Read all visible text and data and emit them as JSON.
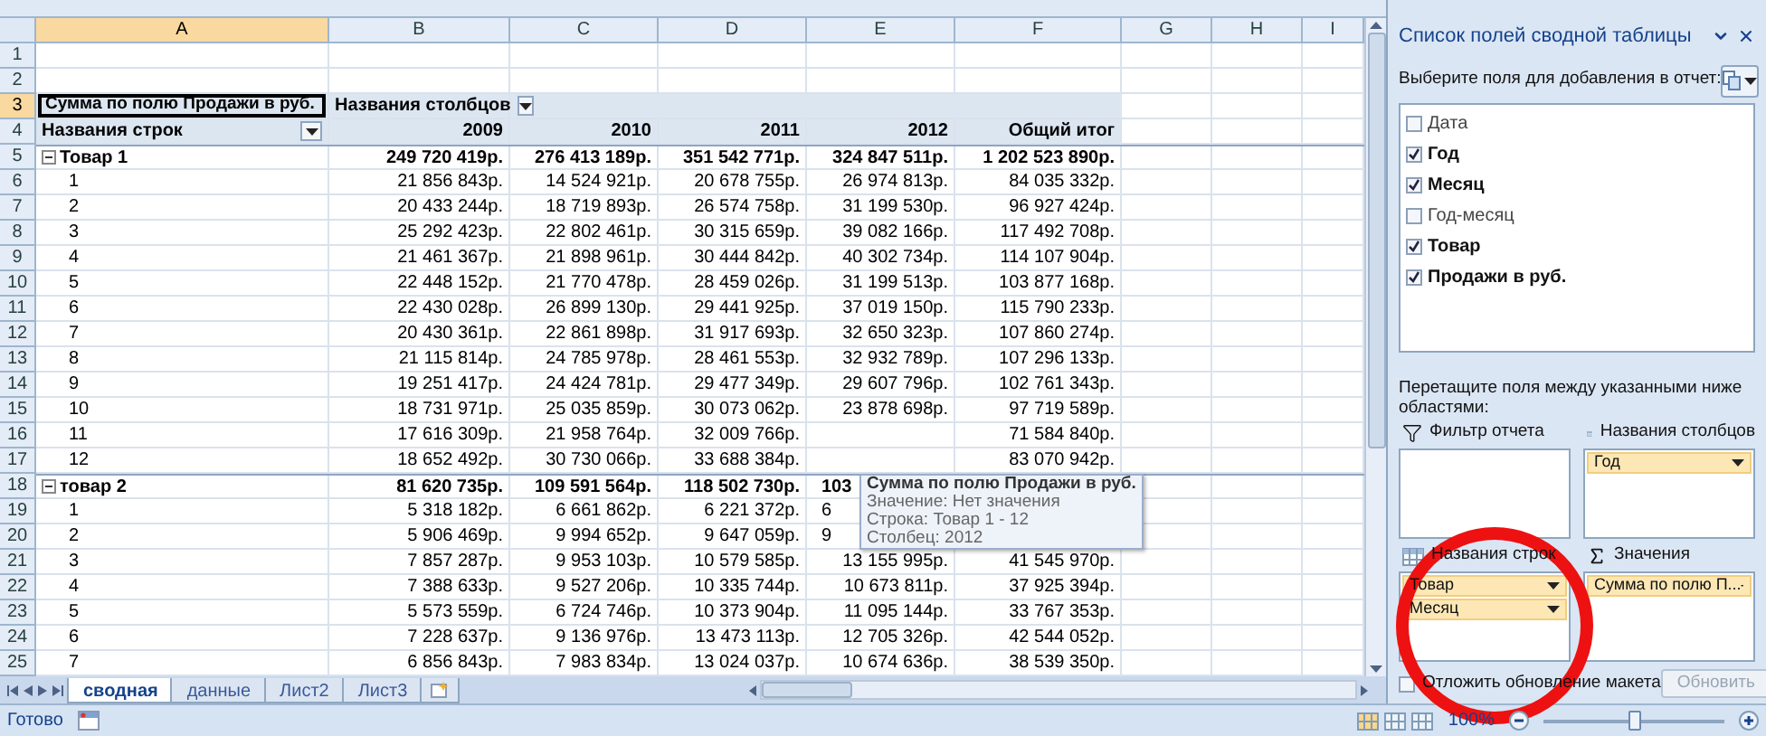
{
  "columns": [
    {
      "label": "A",
      "selected": true
    },
    {
      "label": "B",
      "selected": false
    },
    {
      "label": "C",
      "selected": false
    },
    {
      "label": "D",
      "selected": false
    },
    {
      "label": "E",
      "selected": false
    },
    {
      "label": "F",
      "selected": false
    },
    {
      "label": "G",
      "selected": false
    },
    {
      "label": "H",
      "selected": false
    },
    {
      "label": "I",
      "selected": false
    }
  ],
  "rows": [
    {
      "num": "1",
      "kind": "blank",
      "selected": false
    },
    {
      "num": "2",
      "kind": "blank",
      "selected": false
    },
    {
      "num": "3",
      "kind": "pivot_title",
      "selected": true,
      "label": "Сумма по полю Продажи в руб.",
      "column_label": "Названия столбцов"
    },
    {
      "num": "4",
      "kind": "pivot_header",
      "selected": false,
      "label": "Названия строк",
      "values": [
        "2009",
        "2010",
        "2011",
        "2012",
        "Общий итог"
      ]
    },
    {
      "num": "5",
      "kind": "group",
      "selected": false,
      "expanded": true,
      "label": "Товар 1",
      "cells": {
        "b": "249 720 419р.",
        "c": "276 413 189р.",
        "d": "351 542 771р.",
        "e": "324 847 511р.",
        "f": "1 202 523 890р."
      }
    },
    {
      "num": "6",
      "kind": "item",
      "selected": false,
      "label": "1",
      "cells": {
        "b": "21 856 843р.",
        "c": "14 524 921р.",
        "d": "20 678 755р.",
        "e": "26 974 813р.",
        "f": "84 035 332р."
      }
    },
    {
      "num": "7",
      "kind": "item",
      "selected": false,
      "label": "2",
      "cells": {
        "b": "20 433 244р.",
        "c": "18 719 893р.",
        "d": "26 574 758р.",
        "e": "31 199 530р.",
        "f": "96 927 424р."
      }
    },
    {
      "num": "8",
      "kind": "item",
      "selected": false,
      "label": "3",
      "cells": {
        "b": "25 292 423р.",
        "c": "22 802 461р.",
        "d": "30 315 659р.",
        "e": "39 082 166р.",
        "f": "117 492 708р."
      }
    },
    {
      "num": "9",
      "kind": "item",
      "selected": false,
      "label": "4",
      "cells": {
        "b": "21 461 367р.",
        "c": "21 898 961р.",
        "d": "30 444 842р.",
        "e": "40 302 734р.",
        "f": "114 107 904р."
      }
    },
    {
      "num": "10",
      "kind": "item",
      "selected": false,
      "label": "5",
      "cells": {
        "b": "22 448 152р.",
        "c": "21 770 478р.",
        "d": "28 459 026р.",
        "e": "31 199 513р.",
        "f": "103 877 168р."
      }
    },
    {
      "num": "11",
      "kind": "item",
      "selected": false,
      "label": "6",
      "cells": {
        "b": "22 430 028р.",
        "c": "26 899 130р.",
        "d": "29 441 925р.",
        "e": "37 019 150р.",
        "f": "115 790 233р."
      }
    },
    {
      "num": "12",
      "kind": "item",
      "selected": false,
      "label": "7",
      "cells": {
        "b": "20 430 361р.",
        "c": "22 861 898р.",
        "d": "31 917 693р.",
        "e": "32 650 323р.",
        "f": "107 860 274р."
      }
    },
    {
      "num": "13",
      "kind": "item",
      "selected": false,
      "label": "8",
      "cells": {
        "b": "21 115 814р.",
        "c": "24 785 978р.",
        "d": "28 461 553р.",
        "e": "32 932 789р.",
        "f": "107 296 133р."
      }
    },
    {
      "num": "14",
      "kind": "item",
      "selected": false,
      "label": "9",
      "cells": {
        "b": "19 251 417р.",
        "c": "24 424 781р.",
        "d": "29 477 349р.",
        "e": "29 607 796р.",
        "f": "102 761 343р."
      }
    },
    {
      "num": "15",
      "kind": "item",
      "selected": false,
      "label": "10",
      "cells": {
        "b": "18 731 971р.",
        "c": "25 035 859р.",
        "d": "30 073 062р.",
        "e": "23 878 698р.",
        "f": "97 719 589р."
      }
    },
    {
      "num": "16",
      "kind": "item",
      "selected": false,
      "label": "11",
      "cells": {
        "b": "17 616 309р.",
        "c": "21 958 764р.",
        "d": "32 009 766р.",
        "f": "71 584 840р."
      }
    },
    {
      "num": "17",
      "kind": "item",
      "selected": false,
      "label": "12",
      "cells": {
        "b": "18 652 492р.",
        "c": "30 730 066р.",
        "d": "33 688 384р.",
        "f": "83 070 942р."
      }
    },
    {
      "num": "18",
      "kind": "group",
      "selected": false,
      "expanded": true,
      "covered": true,
      "label": "товар 2",
      "cells": {
        "b": "81 620 735р.",
        "c": "109 591 564р.",
        "d": "118 502 730р.",
        "e": "103"
      }
    },
    {
      "num": "19",
      "kind": "item",
      "selected": false,
      "covered": true,
      "label": "1",
      "cells": {
        "b": "5 318 182р.",
        "c": "6 661 862р.",
        "d": "6 221 372р.",
        "e": "6"
      }
    },
    {
      "num": "20",
      "kind": "item",
      "selected": false,
      "covered": true,
      "label": "2",
      "cells": {
        "b": "5 906 469р.",
        "c": "9 994 652р.",
        "d": "9 647 059р.",
        "e": "9"
      }
    },
    {
      "num": "21",
      "kind": "item",
      "selected": false,
      "label": "3",
      "cells": {
        "b": "7 857 287р.",
        "c": "9 953 103р.",
        "d": "10 579 585р.",
        "e": "13 155 995р.",
        "f": "41 545 970р."
      }
    },
    {
      "num": "22",
      "kind": "item",
      "selected": false,
      "label": "4",
      "cells": {
        "b": "7 388 633р.",
        "c": "9 527 206р.",
        "d": "10 335 744р.",
        "e": "10 673 811р.",
        "f": "37 925 394р."
      }
    },
    {
      "num": "23",
      "kind": "item",
      "selected": false,
      "label": "5",
      "cells": {
        "b": "5 573 559р.",
        "c": "6 724 746р.",
        "d": "10 373 904р.",
        "e": "11 095 144р.",
        "f": "33 767 353р."
      }
    },
    {
      "num": "24",
      "kind": "item",
      "selected": false,
      "label": "6",
      "cells": {
        "b": "7 228 637р.",
        "c": "9 136 976р.",
        "d": "13 473 113р.",
        "e": "12 705 326р.",
        "f": "42 544 052р."
      }
    },
    {
      "num": "25",
      "kind": "item",
      "selected": false,
      "label": "7",
      "cells": {
        "b": "6 856 843р.",
        "c": "7 983 834р.",
        "d": "13 024 037р.",
        "e": "10 674 636р.",
        "f": "38 539 350р."
      }
    }
  ],
  "tooltip": {
    "title": "Сумма по полю Продажи в руб.",
    "lines": [
      "Значение: Нет значения",
      "Строка: Товар 1 - 12",
      "Столбец: 2012"
    ]
  },
  "sheet_tabs": [
    {
      "label": "сводная",
      "selected": true
    },
    {
      "label": "данные",
      "selected": false
    },
    {
      "label": "Лист2",
      "selected": false
    },
    {
      "label": "Лист3",
      "selected": false
    }
  ],
  "status_bar": {
    "text": "Готово",
    "zoom": {
      "label": "100%",
      "level": 0.5
    }
  },
  "field_list": {
    "title": "Список полей сводной таблицы",
    "choose_label": "Выберите поля для добавления в отчет:",
    "fields": [
      {
        "label": "Дата",
        "checked": false
      },
      {
        "label": "Год",
        "checked": true
      },
      {
        "label": "Месяц",
        "checked": true
      },
      {
        "label": "Год-месяц",
        "checked": false
      },
      {
        "label": "Товар",
        "checked": true
      },
      {
        "label": "Продажи в руб.",
        "checked": true
      }
    ],
    "drag_label": "Перетащите поля между указанными ниже областями:",
    "areas": [
      {
        "kind": "filter",
        "label": "Фильтр отчета"
      },
      {
        "kind": "columns",
        "label": "Названия столбцов",
        "items": [
          "Год"
        ]
      },
      {
        "kind": "rows",
        "label": "Названия строк",
        "items": [
          "Товар",
          "Месяц"
        ]
      },
      {
        "kind": "values",
        "label": "Значения",
        "items": [
          "Сумма по полю П..."
        ]
      }
    ],
    "defer": {
      "label": "Отложить обновление макета",
      "checked": false
    },
    "update_button": {
      "label": "Обновить",
      "disabled": true
    }
  }
}
